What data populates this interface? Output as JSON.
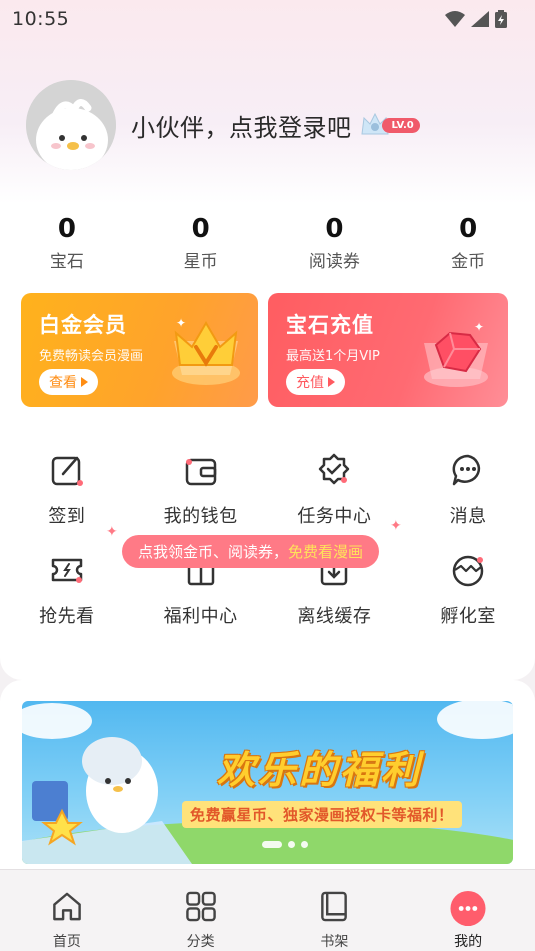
{
  "status": {
    "time": "10:55",
    "icons": [
      "wifi-icon",
      "signal-icon",
      "battery-icon"
    ]
  },
  "profile": {
    "login_prompt": "小伙伴，点我登录吧",
    "level": "LV.0"
  },
  "stats": [
    {
      "value": "0",
      "label": "宝石"
    },
    {
      "value": "0",
      "label": "星币"
    },
    {
      "value": "0",
      "label": "阅读券"
    },
    {
      "value": "0",
      "label": "金币"
    }
  ],
  "cards": {
    "vip": {
      "title": "白金会员",
      "subtitle": "免费畅读会员漫画",
      "button": "查看"
    },
    "gem": {
      "title": "宝石充值",
      "subtitle": "最高送1个月VIP",
      "button": "充值"
    }
  },
  "grid": [
    {
      "label": "签到",
      "icon": "edit-icon"
    },
    {
      "label": "我的钱包",
      "icon": "wallet-icon"
    },
    {
      "label": "任务中心",
      "icon": "badge-check-icon"
    },
    {
      "label": "消息",
      "icon": "chat-icon"
    },
    {
      "label": "抢先看",
      "icon": "ticket-icon"
    },
    {
      "label": "福利中心",
      "icon": "gift-icon"
    },
    {
      "label": "离线缓存",
      "icon": "download-icon"
    },
    {
      "label": "孵化室",
      "icon": "egg-icon"
    }
  ],
  "tooltip": {
    "text": "点我领金币、阅读券，",
    "highlight": "免费看漫画"
  },
  "banner": {
    "title": "欢乐的福利",
    "subtitle": "免费赢星币、独家漫画授权卡等福利！"
  },
  "tabs": [
    {
      "label": "首页",
      "icon": "home-icon"
    },
    {
      "label": "分类",
      "icon": "grid-icon"
    },
    {
      "label": "书架",
      "icon": "book-icon"
    },
    {
      "label": "我的",
      "icon": "profile-dots-icon",
      "active": true
    }
  ],
  "colors": {
    "accent": "#ff5d6c",
    "vip": "#ffa32b",
    "gem": "#ff5d61"
  }
}
